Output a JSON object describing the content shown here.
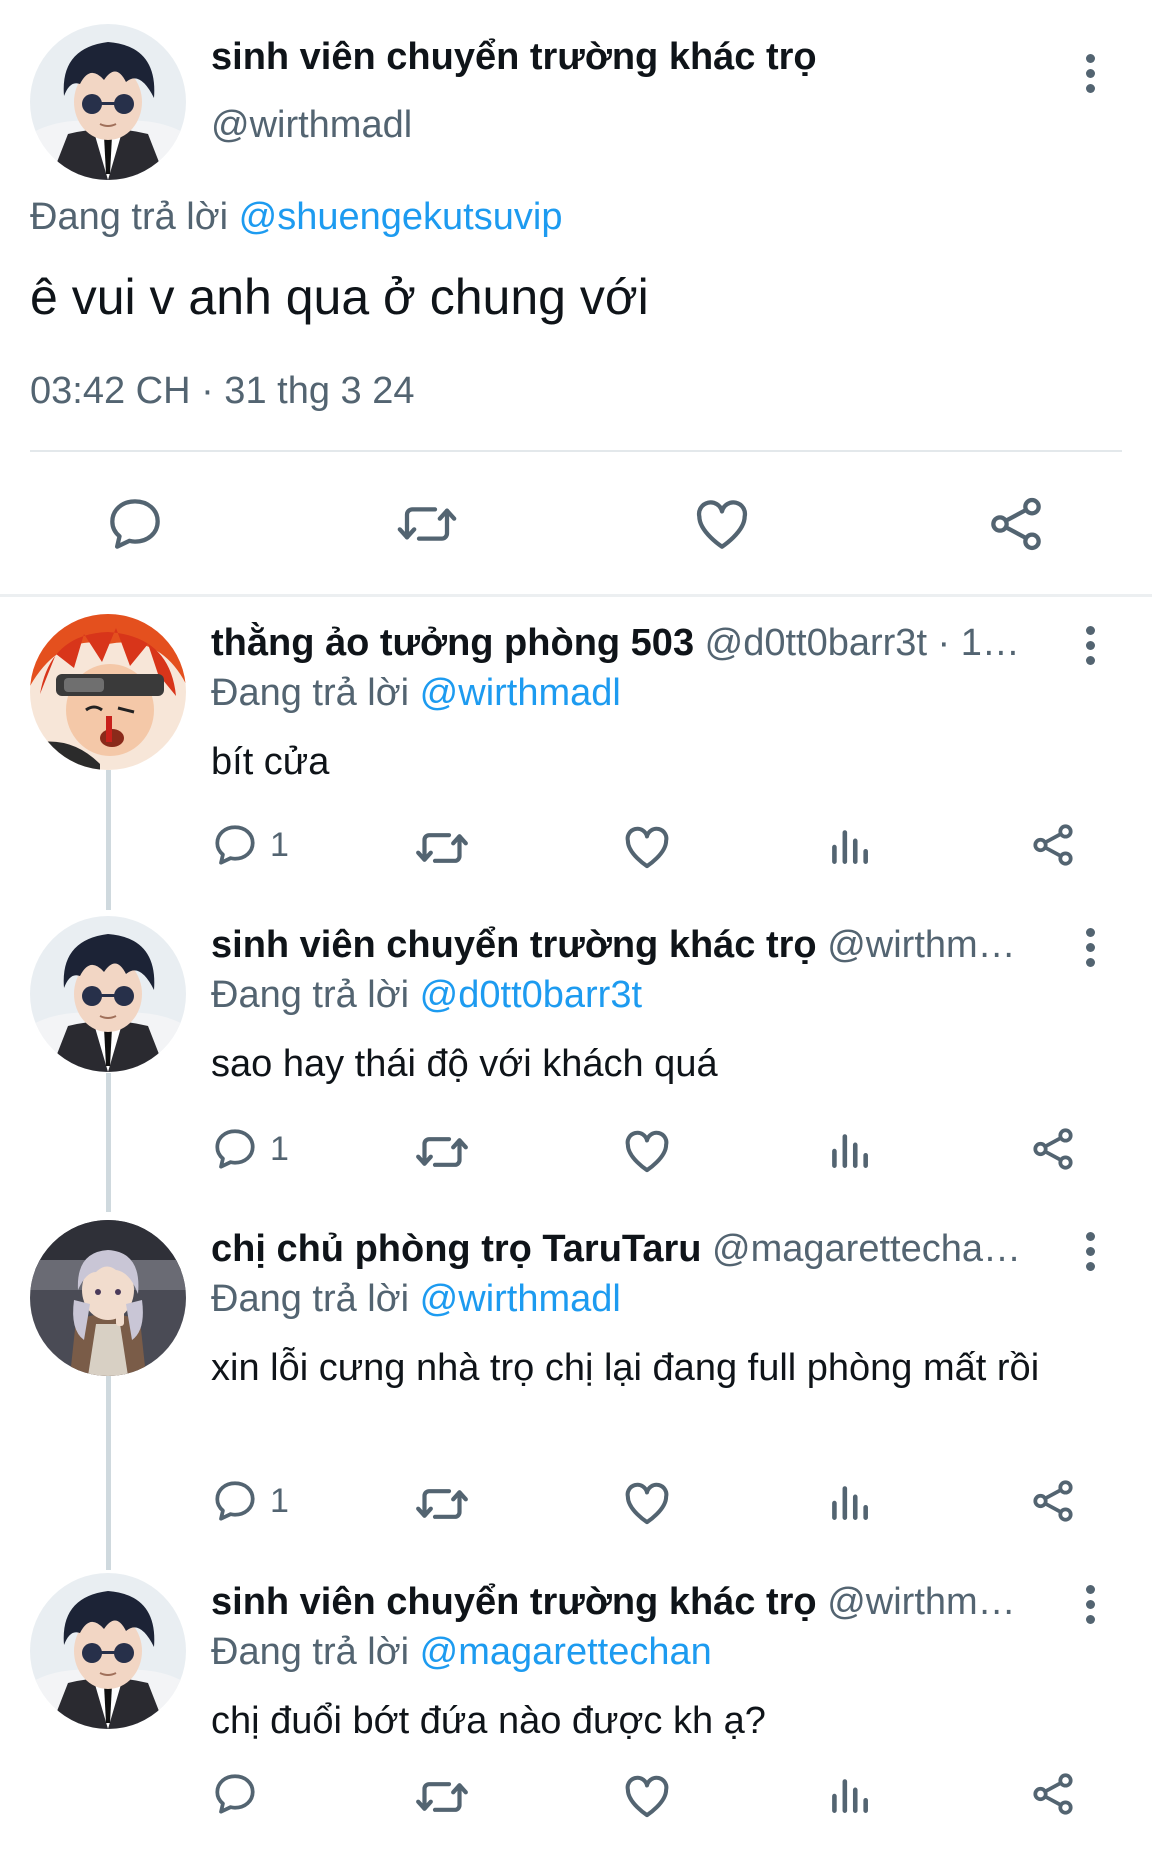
{
  "main_tweet": {
    "author_name": "sinh viên chuyển trường khác trọ",
    "author_handle": "@wirthmadl",
    "replying_prefix": "Đang trả lời",
    "replying_to": "@shuengekutsuvip",
    "text": "ê vui v anh qua ở chung với",
    "timestamp": "03:42 CH · 31 thg 3 24",
    "actions": [
      "reply-icon",
      "retweet-icon",
      "like-icon",
      "share-icon"
    ]
  },
  "replies": [
    {
      "author_name": "thằng ảo tưởng phòng 503",
      "author_handle": "@d0tt0barr3t",
      "meta": " · 1…",
      "replying_prefix": "Đang trả lời",
      "replying_to": "@wirthmadl",
      "text": "bít cửa",
      "reply_count": "1"
    },
    {
      "author_name": "sinh viên chuyển trường khác trọ",
      "author_handle": "@wirthm…",
      "meta": "",
      "replying_prefix": "Đang trả lời",
      "replying_to": "@d0tt0barr3t",
      "text": "sao hay thái độ với khách quá",
      "reply_count": "1"
    },
    {
      "author_name": "chị chủ phòng trọ TaruTaru",
      "author_handle": "@magarettecha…",
      "meta": "",
      "replying_prefix": "Đang trả lời",
      "replying_to": "@wirthmadl",
      "text": "xin lỗi cưng nhà trọ chị lại đang full phòng mất rồi",
      "reply_count": "1"
    },
    {
      "author_name": "sinh viên chuyển trường khác trọ",
      "author_handle": "@wirthm…",
      "meta": "",
      "replying_prefix": "Đang trả lời",
      "replying_to": "@magarettechan",
      "text": "chị đuổi bớt đứa nào được kh ạ?",
      "reply_count": ""
    }
  ],
  "colors": {
    "text": "#0f1419",
    "secondary": "#536471",
    "link": "#1d9bf0",
    "divider": "#e3e8eb",
    "thread_line": "#cfd9de"
  }
}
